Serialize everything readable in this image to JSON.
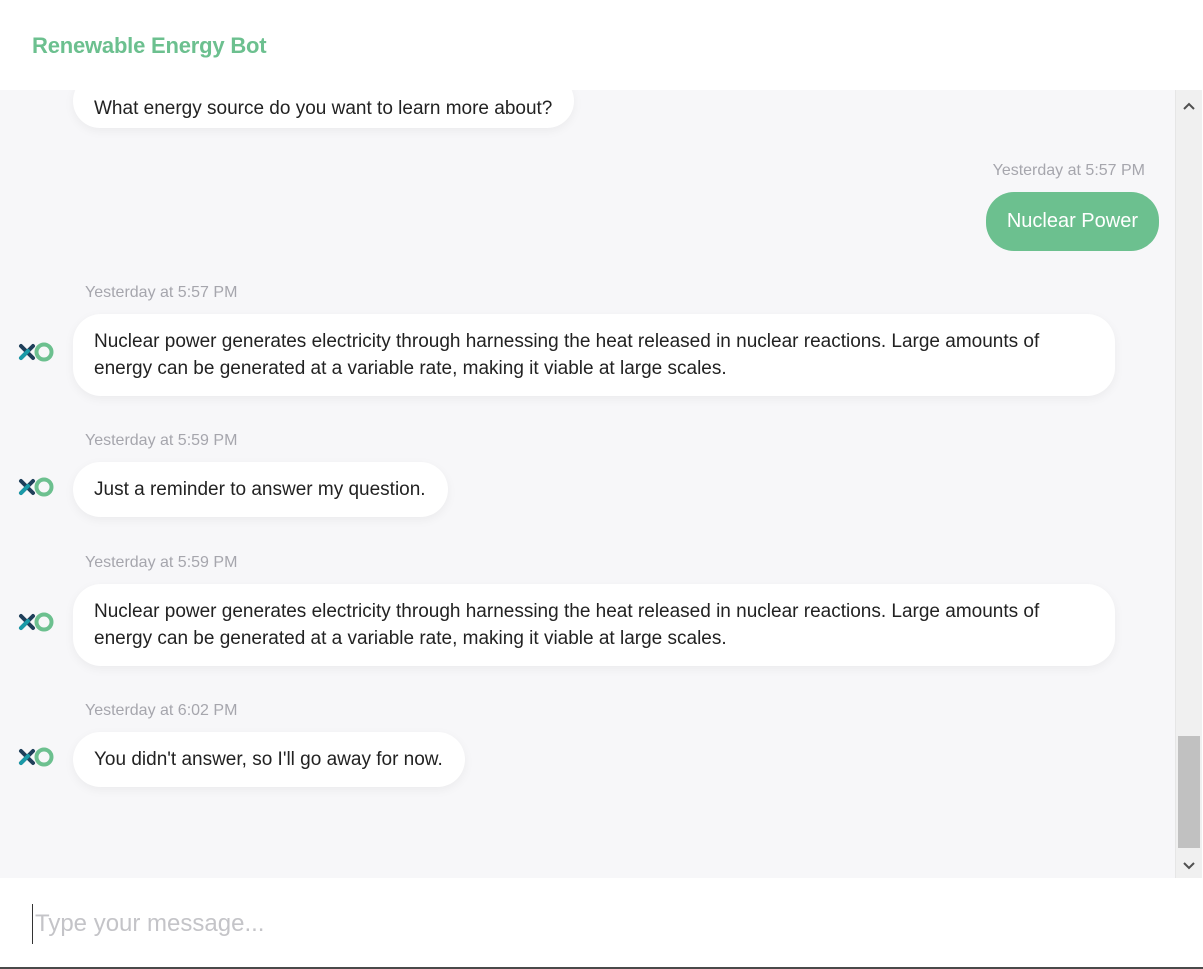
{
  "header": {
    "title": "Renewable Energy Bot"
  },
  "colors": {
    "accent": "#6cc08f",
    "avatar_dark": "#1f3f5a",
    "avatar_teal": "#1a9aa8",
    "pane_bg": "#f7f7f9"
  },
  "messages": [
    {
      "sender": "bot",
      "timestamp": "",
      "text": "What energy source do you want to learn more about?",
      "avatar_icon": "bot-logo-icon"
    },
    {
      "sender": "user",
      "timestamp": "Yesterday at 5:57 PM",
      "text": "Nuclear Power"
    },
    {
      "sender": "bot",
      "timestamp": "Yesterday at 5:57 PM",
      "text": "Nuclear power generates electricity through harnessing the heat released in nuclear reactions. Large amounts of energy can be generated at a variable rate, making it viable at large scales.",
      "avatar_icon": "bot-logo-icon"
    },
    {
      "sender": "bot",
      "timestamp": "Yesterday at 5:59 PM",
      "text": "Just a reminder to answer my question.",
      "avatar_icon": "bot-logo-icon"
    },
    {
      "sender": "bot",
      "timestamp": "Yesterday at 5:59 PM",
      "text": "Nuclear power generates electricity through harnessing the heat released in nuclear reactions. Large amounts of energy can be generated at a variable rate, making it viable at large scales.",
      "avatar_icon": "bot-logo-icon"
    },
    {
      "sender": "bot",
      "timestamp": "Yesterday at 6:02 PM",
      "text": "You didn't answer, so I'll go away for now.",
      "avatar_icon": "bot-logo-icon"
    }
  ],
  "composer": {
    "placeholder": "Type your message...",
    "value": ""
  },
  "scrollbar": {
    "up_icon": "scroll-up-arrow-icon",
    "down_icon": "scroll-down-arrow-icon"
  }
}
